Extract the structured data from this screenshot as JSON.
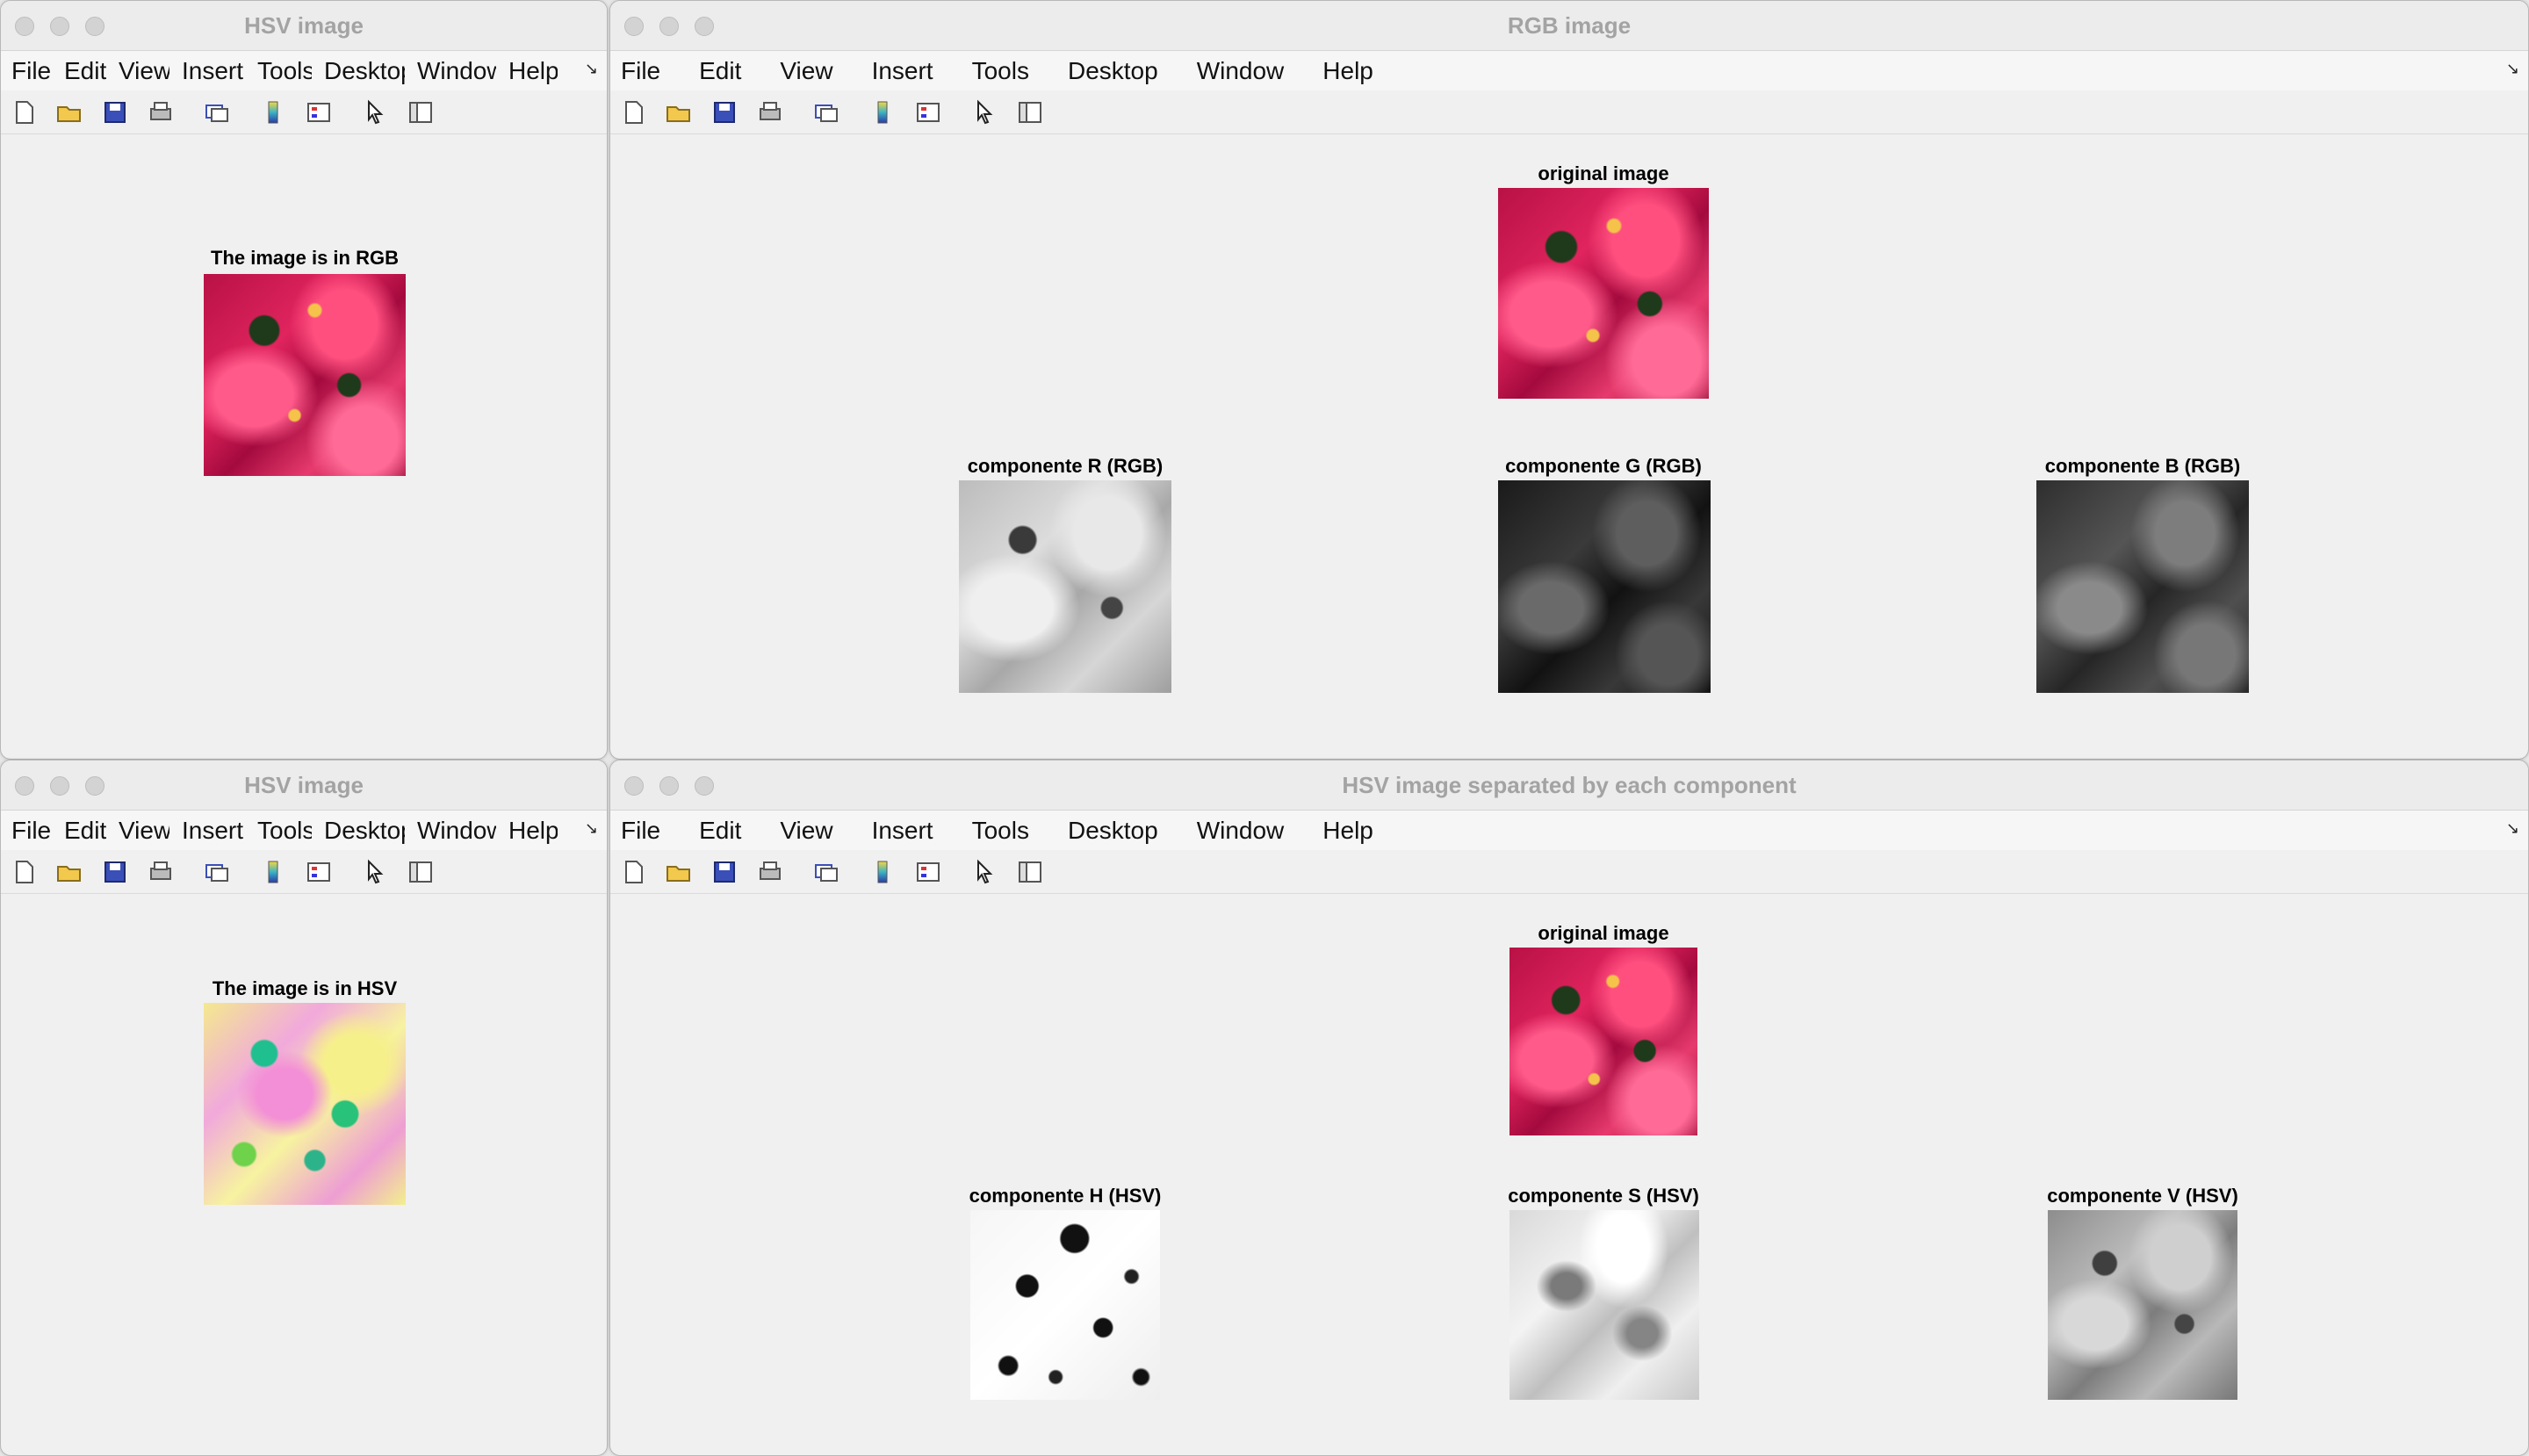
{
  "windows": {
    "top_left": {
      "title": "HSV image",
      "menu": [
        "File",
        "Edit",
        "View",
        "Insert",
        "Tools",
        "Desktop",
        "Window",
        "Help"
      ],
      "axes_title": "The image is in RGB"
    },
    "top_right": {
      "title": "RGB image",
      "menu": [
        "File",
        "Edit",
        "View",
        "Insert",
        "Tools",
        "Desktop",
        "Window",
        "Help"
      ],
      "original_title": "original image",
      "components": [
        "componente R (RGB)",
        "componente G (RGB)",
        "componente B (RGB)"
      ]
    },
    "bottom_left": {
      "title": "HSV image",
      "menu": [
        "File",
        "Edit",
        "View",
        "Insert",
        "Tools",
        "Desktop",
        "Window",
        "Help"
      ],
      "axes_title": "The image is in HSV"
    },
    "bottom_right": {
      "title": "HSV image separated by each component",
      "menu": [
        "File",
        "Edit",
        "View",
        "Insert",
        "Tools",
        "Desktop",
        "Window",
        "Help"
      ],
      "original_title": "original image",
      "components": [
        "componente H (HSV)",
        "componente S (HSV)",
        "componente V (HSV)"
      ]
    }
  },
  "toolbar_icons": [
    "new-figure-icon",
    "open-file-icon",
    "save-icon",
    "print-icon",
    "link-plot-icon",
    "colorbar-icon",
    "legend-icon",
    "edit-plot-arrow-icon",
    "property-inspector-icon"
  ],
  "colors": {
    "window_bg": "#f0f0f0",
    "title_text": "#a3a3a3",
    "menu_text": "#111111"
  }
}
